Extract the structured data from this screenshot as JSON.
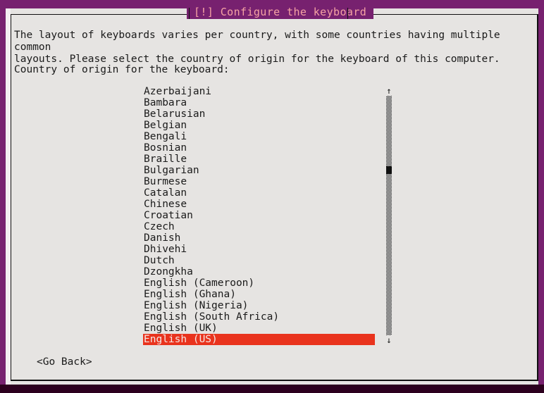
{
  "window": {
    "title": "[!] Configure the keyboard",
    "title_color": "#f5a3a3",
    "background_color": "#77216f",
    "dialog_background": "#e6e4e2"
  },
  "body": {
    "intro": "The layout of keyboards varies per country, with some countries having multiple common\nlayouts. Please select the country of origin for the keyboard of this computer.",
    "prompt": "Country of origin for the keyboard:"
  },
  "list": {
    "selected_index": 22,
    "selected_value": "English (US)",
    "highlight_color": "#e9331d",
    "highlight_text_color": "#f6e9e6",
    "items": [
      "Azerbaijani",
      "Bambara",
      "Belarusian",
      "Belgian",
      "Bengali",
      "Bosnian",
      "Braille",
      "Bulgarian",
      "Burmese",
      "Catalan",
      "Chinese",
      "Croatian",
      "Czech",
      "Danish",
      "Dhivehi",
      "Dutch",
      "Dzongkha",
      "English (Cameroon)",
      "English (Ghana)",
      "English (Nigeria)",
      "English (South Africa)",
      "English (UK)",
      "English (US)"
    ]
  },
  "scrollbar": {
    "up_arrow": "↑",
    "down_arrow": "↓"
  },
  "buttons": {
    "go_back": "<Go Back>"
  }
}
